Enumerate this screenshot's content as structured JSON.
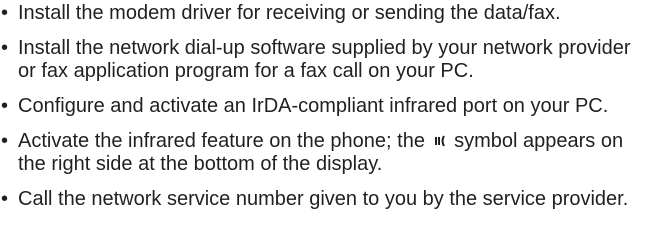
{
  "bullet_symbol": "•",
  "items": [
    {
      "text": "Install the modem driver for receiving or sending the data/fax."
    },
    {
      "text": "Install the network dial-up software supplied by your network provider or fax application program for a fax call on your PC."
    },
    {
      "text": "Configure and activate an IrDA-compliant infrared port on your PC."
    },
    {
      "text_before_icon": "Activate the infrared feature on the phone; the",
      "icon": "infrared-symbol-icon",
      "text_after_icon": "symbol appears on the right side at the bottom of the display."
    },
    {
      "text": "Call the network service number given to you by the service provider."
    }
  ]
}
